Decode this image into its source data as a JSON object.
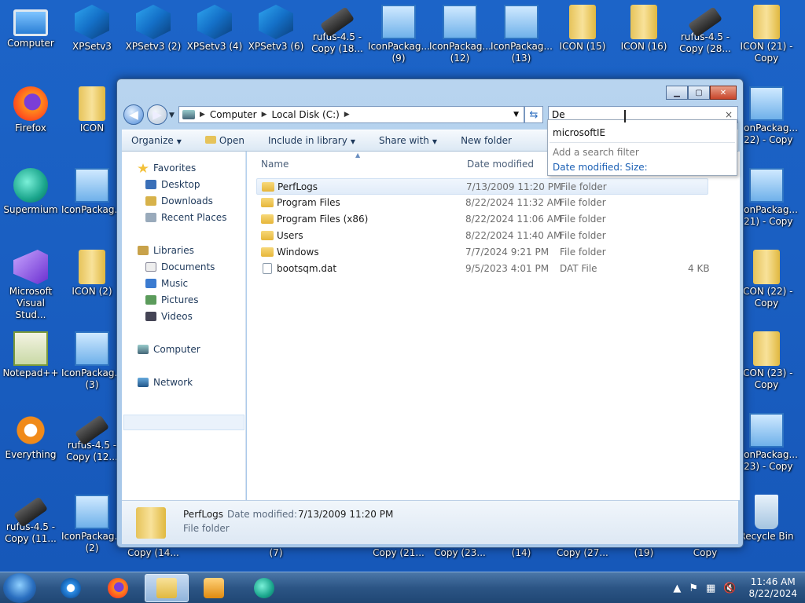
{
  "desktop": {
    "left_icons": [
      {
        "label": "Computer",
        "icon": "computer-icon"
      },
      {
        "label": "XPSetv3",
        "icon": "cube-icon"
      },
      {
        "label": "XPSetv3 (2)",
        "icon": "cube-icon"
      },
      {
        "label": "XPSetv3 (4)",
        "icon": "cube-icon"
      },
      {
        "label": "XPSetv3 (6)",
        "icon": "cube-icon"
      },
      {
        "label": "rufus-4.5 - Copy (18...",
        "icon": "usb-icon"
      },
      {
        "label": "IconPackag... (9)",
        "icon": "shield-icon"
      },
      {
        "label": "IconPackag... (12)",
        "icon": "shield-icon"
      },
      {
        "label": "IconPackag... (13)",
        "icon": "shield-icon"
      },
      {
        "label": "ICON (15)",
        "icon": "folder-icon"
      },
      {
        "label": "ICON (16)",
        "icon": "folder-icon"
      },
      {
        "label": "rufus-4.5 - Copy (28...",
        "icon": "usb-icon"
      },
      {
        "label": "ICON (21) - Copy",
        "icon": "folder-icon"
      }
    ],
    "col1": [
      "Firefox",
      "Supermium",
      "Microsoft Visual Stud...",
      "Notepad++",
      "Everything",
      "rufus-4.5 - Copy (11..."
    ],
    "col2": [
      "ICON",
      "IconPackag...",
      "ICON (2)",
      "IconPackag... (3)",
      "rufus-4.5 - Copy (12...",
      "IconPackag... (2)"
    ],
    "right_col": [
      "IconPackag... (22) - Copy",
      "IconPackag... (21) - Copy",
      "ICON (22) - Copy",
      "ICON (23) - Copy",
      "IconPackag... (23) - Copy",
      "Recycle Bin"
    ],
    "bottom_partial": [
      "Copy (14...",
      "(7)",
      "Copy (21...",
      "Copy (23...",
      "(14)",
      "Copy (27...",
      "(19)",
      "Copy"
    ]
  },
  "explorer": {
    "breadcrumb": [
      "Computer",
      "Local Disk (C:)"
    ],
    "search_value": "De",
    "search_dropdown": {
      "suggestion": "microsoftIE",
      "add_filter": "Add a search filter",
      "filter1": "Date modified:",
      "filter2": "Size:"
    },
    "toolbar": [
      "Organize",
      "Open",
      "Include in library",
      "Share with",
      "New folder"
    ],
    "nav": {
      "favorites": "Favorites",
      "desktop": "Desktop",
      "downloads": "Downloads",
      "recent": "Recent Places",
      "libraries": "Libraries",
      "documents": "Documents",
      "music": "Music",
      "pictures": "Pictures",
      "videos": "Videos",
      "computer": "Computer",
      "network": "Network"
    },
    "columns": {
      "name": "Name",
      "date": "Date modified"
    },
    "rows": [
      {
        "name": "PerfLogs",
        "date": "7/13/2009 11:20 PM",
        "type": "File folder",
        "size": ""
      },
      {
        "name": "Program Files",
        "date": "8/22/2024 11:32 AM",
        "type": "File folder",
        "size": ""
      },
      {
        "name": "Program Files (x86)",
        "date": "8/22/2024 11:06 AM",
        "type": "File folder",
        "size": ""
      },
      {
        "name": "Users",
        "date": "8/22/2024 11:40 AM",
        "type": "File folder",
        "size": ""
      },
      {
        "name": "Windows",
        "date": "7/7/2024 9:21 PM",
        "type": "File folder",
        "size": ""
      },
      {
        "name": "bootsqm.dat",
        "date": "9/5/2023 4:01 PM",
        "type": "DAT File",
        "size": "4 KB"
      }
    ],
    "details": {
      "name": "PerfLogs",
      "date_label": "Date modified:",
      "date_value": "7/13/2009 11:20 PM",
      "type": "File folder"
    }
  },
  "taskbar": {
    "time": "11:46 AM",
    "date": "8/22/2024"
  }
}
